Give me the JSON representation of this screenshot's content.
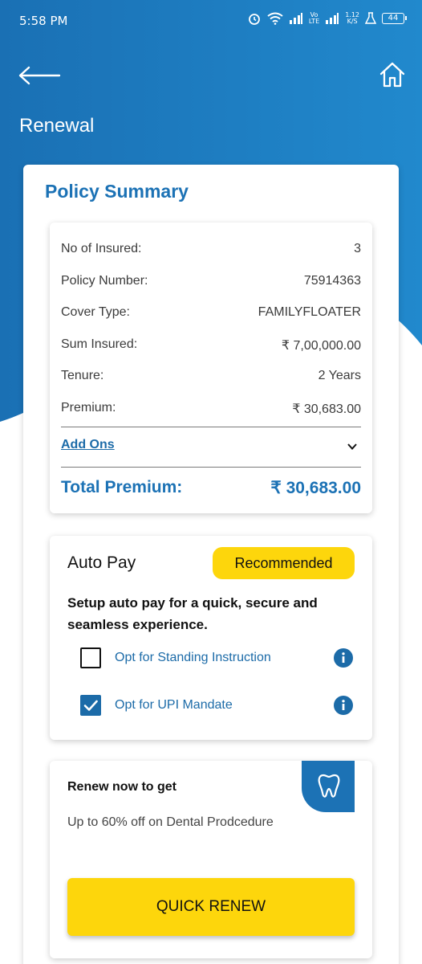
{
  "status_bar": {
    "time": "5:58 PM",
    "net_speed_value": "1.12",
    "net_speed_unit": "K/S",
    "lte_top": "Vo",
    "lte_bottom": "LTE",
    "battery": "44"
  },
  "header": {
    "title": "Renewal",
    "back_icon": "arrow-left-icon",
    "home_icon": "home-icon"
  },
  "policy_summary": {
    "title": "Policy Summary",
    "rows": [
      {
        "label": "No of Insured:",
        "value": "3"
      },
      {
        "label": "Policy Number:",
        "value": "75914363"
      },
      {
        "label": "Cover Type:",
        "value": "FAMILYFLOATER"
      },
      {
        "label": "Sum Insured:",
        "value": "₹ 7,00,000.00"
      },
      {
        "label": "Tenure:",
        "value": "2 Years"
      },
      {
        "label": "Premium:",
        "value": "₹ 30,683.00"
      }
    ],
    "add_ons_label": "Add Ons",
    "total_label": "Total Premium:",
    "total_value": "₹ 30,683.00"
  },
  "auto_pay": {
    "title": "Auto Pay",
    "badge": "Recommended",
    "description": "Setup auto pay for a quick, secure and seamless experience.",
    "options": [
      {
        "label": "Opt for Standing Instruction",
        "checked": false
      },
      {
        "label": "Opt for UPI Mandate",
        "checked": true
      }
    ]
  },
  "renew_offer": {
    "title": "Renew now to get",
    "description": "Up to 60% off on Dental Prodcedure",
    "icon": "tooth-icon",
    "button_label": "QUICK RENEW"
  },
  "colors": {
    "primary_blue": "#1c72b5",
    "accent_yellow": "#fdd60c"
  }
}
